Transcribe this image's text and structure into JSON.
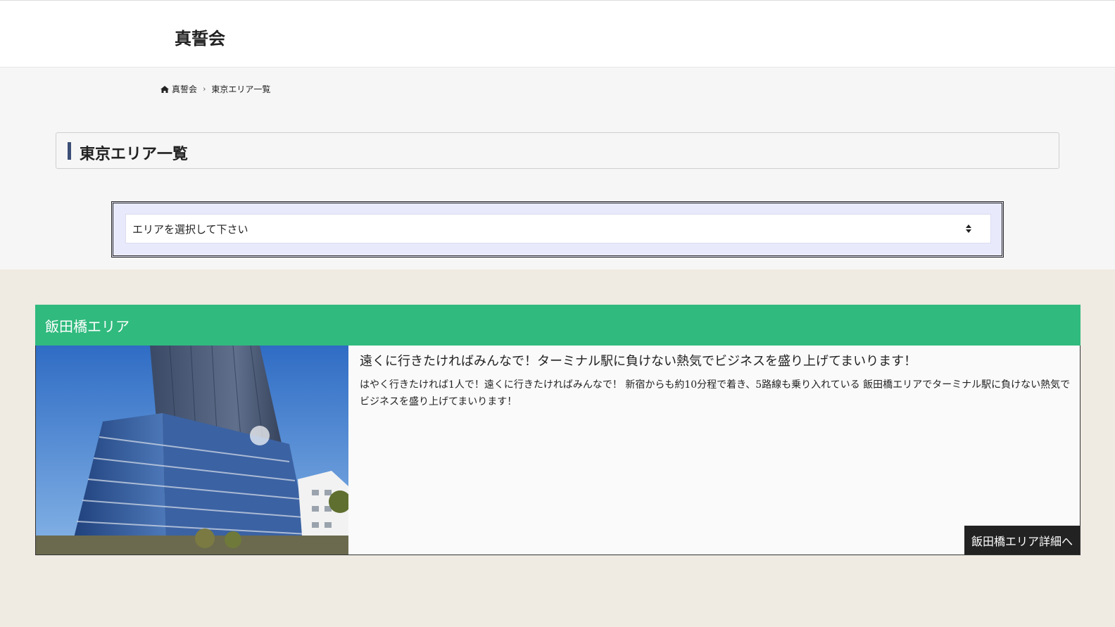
{
  "header": {
    "site_title": "真誓会"
  },
  "breadcrumb": {
    "home_label": "真誓会",
    "separator": "›",
    "current": "東京エリア一覧"
  },
  "page": {
    "title": "東京エリア一覧"
  },
  "area_select": {
    "selected_label": "エリアを選択して下さい"
  },
  "areas": [
    {
      "name": "飯田橋エリア",
      "heading": "遠くに行きたければみんなで！ターミナル駅に負けない熱気でビジネスを盛り上げてまいります！",
      "description": "はやく行きたければ1人で！遠くに行きたければみんなで！ 新宿からも約10分程で着き、5路線も乗り入れている 飯田橋エリアでターミナル駅に負けない熱気でビジネスを盛り上げてまいります！",
      "detail_label": "飯田橋エリア詳細へ"
    }
  ],
  "colors": {
    "accent_green": "#30ba7e",
    "title_bar": "#3c4f77",
    "select_frame_bg": "#e8e9fb"
  }
}
